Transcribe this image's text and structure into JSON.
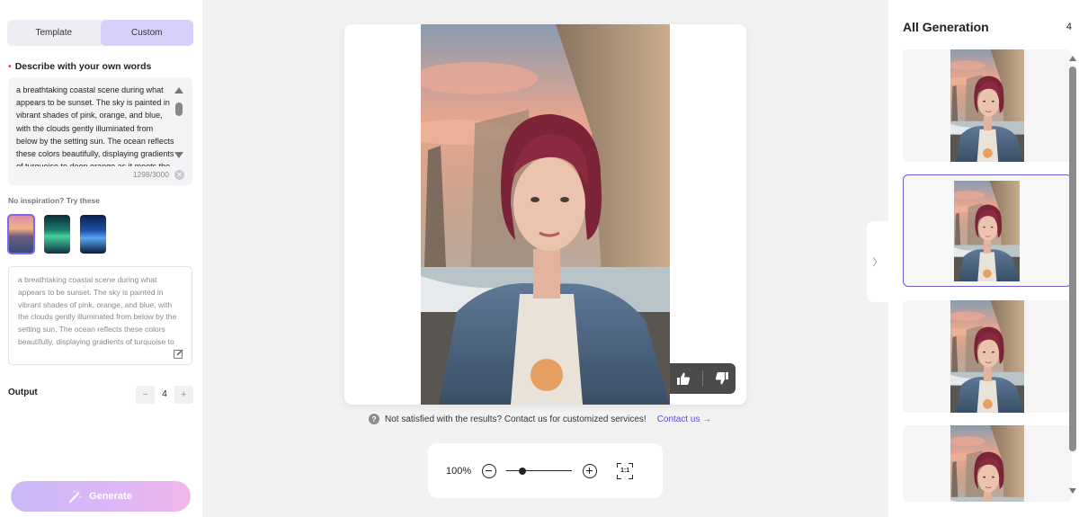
{
  "left": {
    "tabs": [
      {
        "label": "Template",
        "active": false
      },
      {
        "label": "Custom",
        "active": true
      }
    ],
    "section_title": "Describe with your own words",
    "description": "a breathtaking coastal scene during what appears to be sunset. The sky is painted in vibrant shades of pink, orange, and blue, with the clouds gently illuminated from below by the setting sun. The ocean reflects these colors beautifully, displaying gradients of turquoise to deep orange as it meets the",
    "char_count": "1298/3000",
    "inspiration_label": "No inspiration? Try these",
    "suggestion_text": "a breathtaking coastal scene during what appears to be sunset. The sky is painted in vibrant shades of pink, orange, and blue, with the clouds gently illuminated from below by the setting sun. The ocean reflects these colors beautifully, displaying gradients of turquoise to deep oran...",
    "output_label": "Output",
    "output_value": "4",
    "minus": "−",
    "plus": "+",
    "generate_label": "Generate"
  },
  "center": {
    "help_text": "Not satisfied with the results? Contact us for customized services!",
    "help_icon": "?",
    "contact_label": "Contact us",
    "contact_arrow": "→",
    "zoom": {
      "percent_label": "100%",
      "level": 0.25,
      "fit_label": "1:1"
    }
  },
  "right": {
    "title": "All Generation",
    "count": "4",
    "collapse_glyph": "〉"
  },
  "icons": {
    "like": "thumbs-up-icon",
    "dislike": "thumbs-down-icon",
    "edit": "edit-icon",
    "generate": "magic-wand-icon",
    "help": "question-icon",
    "zoom_out": "zoom-out-icon",
    "zoom_in": "zoom-in-icon",
    "fit": "fit-screen-icon",
    "clear": "clear-icon"
  },
  "colors": {
    "accent": "#6b5cd6",
    "tab_active": "#d6d0fa",
    "generate_start": "#c9b9f7",
    "generate_end": "#f2b6ea",
    "contact": "#5b4bd6"
  }
}
